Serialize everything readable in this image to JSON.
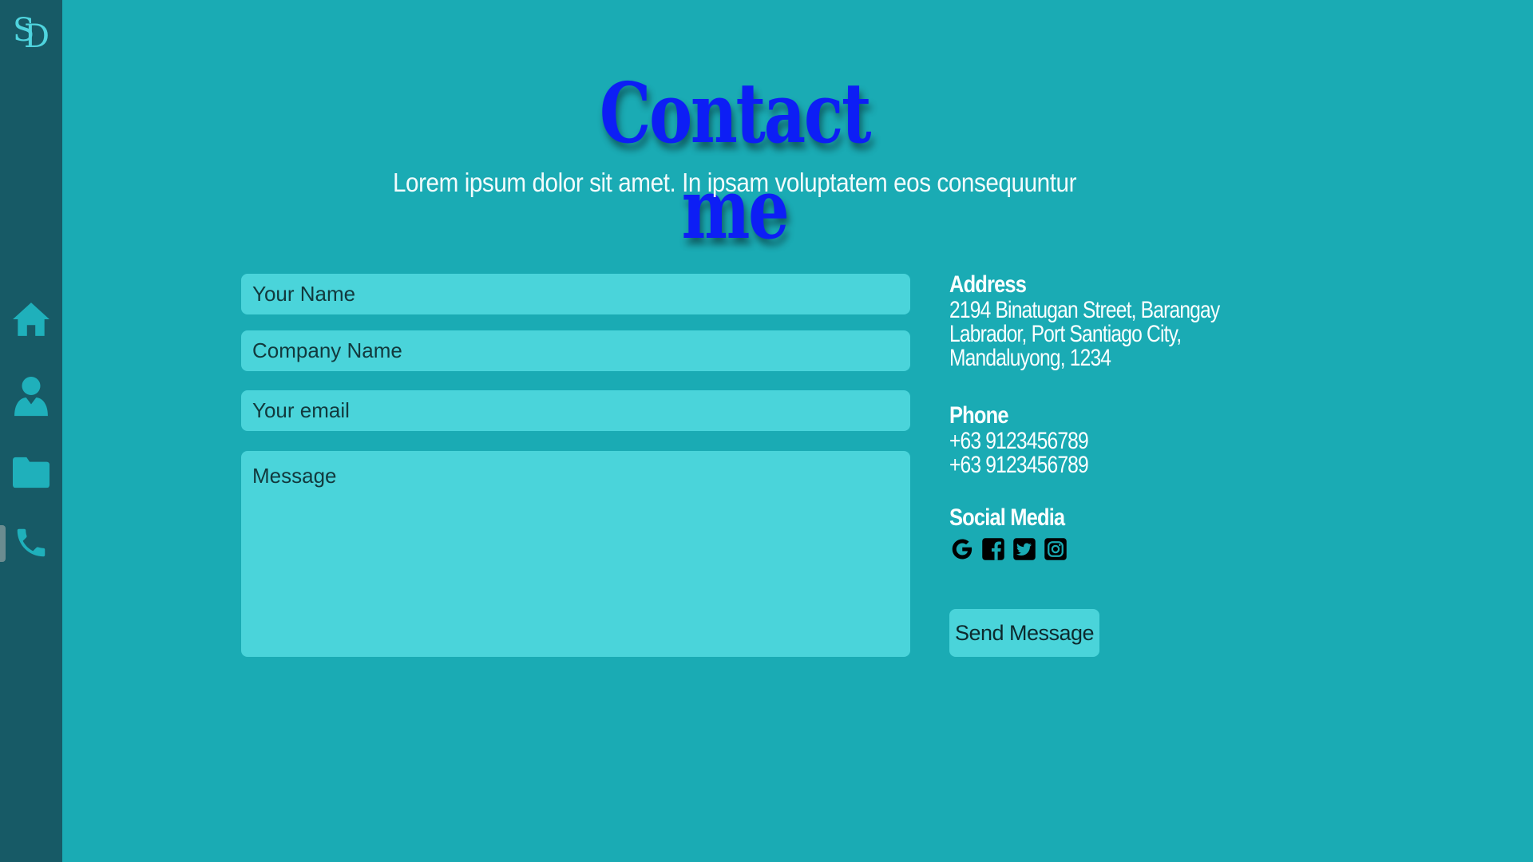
{
  "brand": {
    "logo_text_s": "S",
    "logo_text_d": "D"
  },
  "sidebar": {
    "items": [
      {
        "label": "Home",
        "icon": "home-icon"
      },
      {
        "label": "About",
        "icon": "user-icon"
      },
      {
        "label": "Projects",
        "icon": "folder-icon"
      },
      {
        "label": "Contact",
        "icon": "phone-icon",
        "active": true
      }
    ]
  },
  "header": {
    "title": "Contact me",
    "subtitle": "Lorem ipsum dolor sit amet. In ipsam voluptatem eos consequuntur"
  },
  "form": {
    "name_placeholder": "Your Name",
    "company_placeholder": "Company Name",
    "email_placeholder": "Your email",
    "message_placeholder": "Message",
    "send_label": "Send Message"
  },
  "info": {
    "address_heading": "Address",
    "address_lines": [
      "2194 Binatugan Street, Barangay",
      "Labrador, Port Santiago City,",
      "Mandaluyong, 1234"
    ],
    "phone_heading": "Phone",
    "phones": [
      "+63 9123456789",
      "+63 9123456789"
    ],
    "social_heading": "Social Media",
    "social_icons": [
      "google-icon",
      "facebook-icon",
      "twitter-icon",
      "instagram-icon"
    ]
  },
  "colors": {
    "background": "#1aabb4",
    "sidebar": "#175a66",
    "title": "#0d1ef5",
    "field": "#4ad4da"
  }
}
